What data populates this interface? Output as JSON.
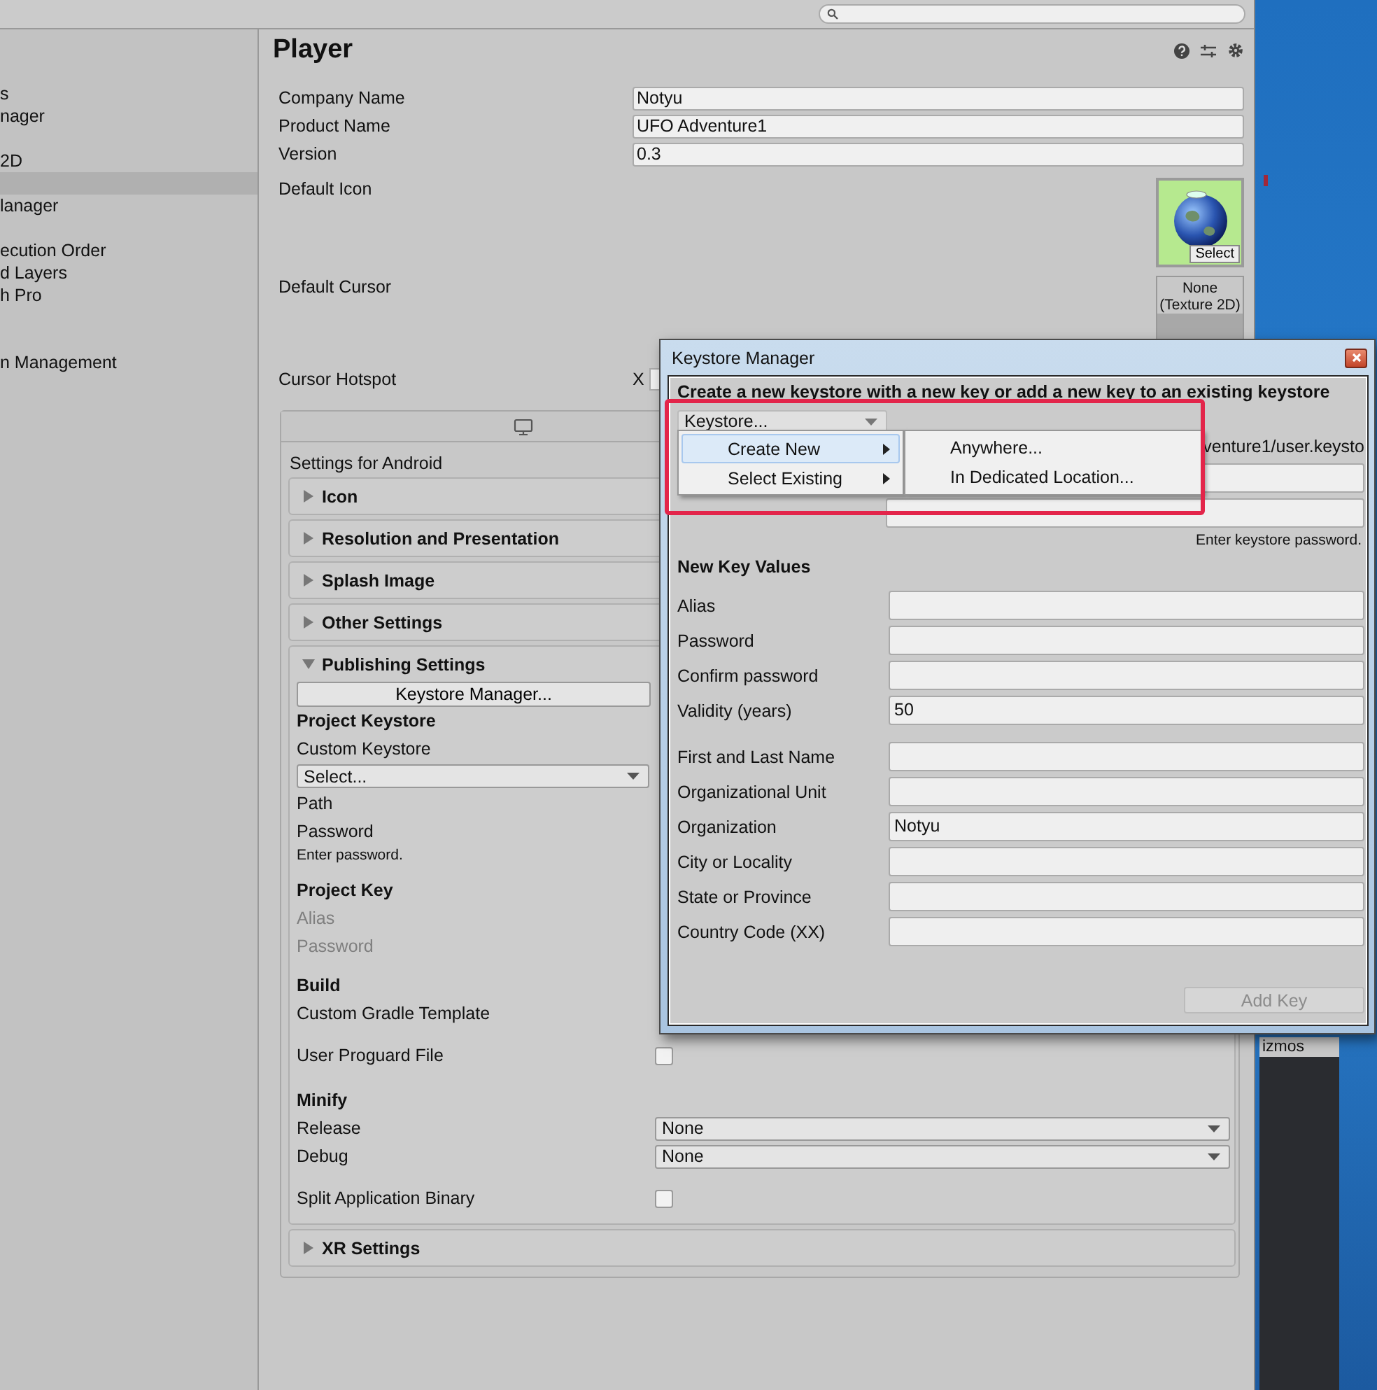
{
  "sidebar": {
    "items": [
      {
        "label": "s",
        "selected": false
      },
      {
        "label": "nager",
        "selected": false
      },
      {
        "label": "2D",
        "selected": false
      },
      {
        "selected": true
      },
      {
        "label": "lanager",
        "selected": false
      },
      {
        "label": "ecution Order",
        "selected": false
      },
      {
        "label": "d Layers",
        "selected": false
      },
      {
        "label": "h Pro",
        "selected": false
      },
      {
        "label": "n Management",
        "selected": false
      }
    ]
  },
  "inspector": {
    "title": "Player",
    "fields": [
      {
        "label": "Company Name",
        "value": "Notyu"
      },
      {
        "label": "Product Name",
        "value": "UFO Adventure1"
      },
      {
        "label": "Version",
        "value": "0.3"
      }
    ],
    "default_icon": {
      "label": "Default Icon",
      "button": "Select"
    },
    "default_cursor": {
      "label": "Default Cursor",
      "value_lines": [
        "None",
        "(Texture 2D)"
      ]
    },
    "cursor_hotspot": {
      "label": "Cursor Hotspot",
      "axis": "X"
    },
    "platform_caption": "Settings for Android",
    "sections": [
      {
        "title": "Icon",
        "expanded": false
      },
      {
        "title": "Resolution and Presentation",
        "expanded": false
      },
      {
        "title": "Splash Image",
        "expanded": false
      },
      {
        "title": "Other Settings",
        "expanded": false
      },
      {
        "title": "Publishing Settings",
        "expanded": true,
        "rows": [
          {
            "kind": "button",
            "text": "Keystore Manager..."
          },
          {
            "kind": "heading",
            "text": "Project Keystore"
          },
          {
            "kind": "label",
            "text": "Custom Keystore",
            "disabled": false
          },
          {
            "kind": "dropdown",
            "value": "Select..."
          },
          {
            "kind": "label",
            "text": "Path",
            "disabled": false
          },
          {
            "kind": "label",
            "text": "Password",
            "disabled": false
          },
          {
            "kind": "hint",
            "text": "Enter password."
          },
          {
            "kind": "heading",
            "text": "Project Key"
          },
          {
            "kind": "label",
            "text": "Alias",
            "disabled": true
          },
          {
            "kind": "label",
            "text": "Password",
            "disabled": true
          },
          {
            "kind": "heading",
            "text": "Build"
          },
          {
            "kind": "label",
            "text": "Custom Gradle Template",
            "disabled": false
          },
          {
            "kind": "checkbox",
            "text": "User Proguard File",
            "checked": false
          },
          {
            "kind": "heading",
            "text": "Minify"
          },
          {
            "kind": "select",
            "text": "Release",
            "value": "None"
          },
          {
            "kind": "select",
            "text": "Debug",
            "value": "None"
          },
          {
            "kind": "checkbox",
            "text": "Split Application Binary",
            "checked": false
          }
        ]
      },
      {
        "title": "XR Settings",
        "expanded": false
      }
    ]
  },
  "keystore_manager": {
    "title": "Keystore Manager",
    "heading": "Create a new keystore with a new key or add a new key to an existing keystore",
    "keystore_dropdown": "Keystore...",
    "path": "venture1/user.keysto",
    "password_hint": "Enter keystore password.",
    "section_title": "New Key Values",
    "key_fields": [
      {
        "label": "Alias"
      },
      {
        "label": "Password"
      },
      {
        "label": "Confirm password"
      },
      {
        "label": "Validity (years)",
        "value": "50"
      }
    ],
    "certificate_fields": [
      {
        "label": "First and Last Name"
      },
      {
        "label": "Organizational Unit"
      },
      {
        "label": "Organization",
        "value": "Notyu"
      },
      {
        "label": "City or Locality"
      },
      {
        "label": "State or Province"
      },
      {
        "label": "Country Code (XX)"
      }
    ],
    "add_button": {
      "label": "Add Key",
      "disabled": true
    }
  },
  "menu": {
    "items": [
      {
        "label": "Create New",
        "selected": true
      },
      {
        "label": "Select Existing",
        "selected": false
      }
    ],
    "submenu": [
      "Anywhere...",
      "In Dedicated Location..."
    ]
  },
  "desktop": {
    "panel_label": "izmos"
  }
}
